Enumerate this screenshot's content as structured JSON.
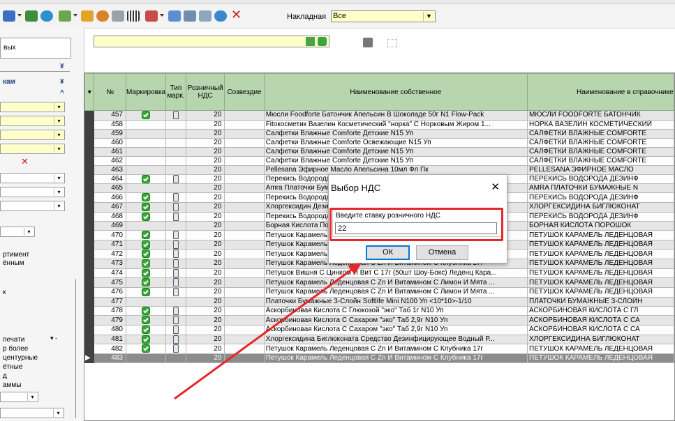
{
  "toolbar": {
    "nakladnaya_label": "Накладная",
    "nakladnaya_value": "Все",
    "icons": [
      "refresh-icon",
      "excel-icon",
      "globe-icon",
      "puzzle-icon",
      "filter-icon",
      "box-icon",
      "wrench-icon",
      "barcode-icon",
      "scale-icon",
      "copy-icon",
      "copy2-icon",
      "copy3-icon",
      "sync-icon",
      "delete-icon"
    ]
  },
  "left_panel": {
    "text_vyh": "вых",
    "text_kam": "кам",
    "text_assortiment": "ртимент",
    "text_yonnym": "ённым",
    "text_k": "к",
    "text_pechati": "печати",
    "text_p_bolee": "р более",
    "text_centurnye": "центурные",
    "text_yotnye": "ётные",
    "text_d": "д",
    "text_ammy": "аммы"
  },
  "grid": {
    "columns": [
      "№",
      "Маркировка",
      "Тип марк.",
      "Розничный НДС",
      "Созвездие",
      "Наименование собственное",
      "Наименование в справочнике"
    ],
    "rows": [
      {
        "n": "457",
        "mark": true,
        "typ": "pack",
        "nds": "20",
        "name": "Мюсли Foodforte Батончик Апельсин В Шоколаде 50г N1 Flow-Pack",
        "ref": "МЮСЛИ FOODFORTE БАТОНЧИК"
      },
      {
        "n": "458",
        "mark": false,
        "typ": "",
        "nds": "20",
        "name": "Fitoкосметик Вазелин Косметический \"норка\" С Норковым Жиром 1...",
        "ref": "НОРКА ВАЗЕЛИН КОСМЕТИЧЕСКИЙ"
      },
      {
        "n": "459",
        "mark": false,
        "typ": "",
        "nds": "20",
        "name": "Салфетки Влажные Comforte Детские N15 Уп",
        "ref": "САЛФЕТКИ ВЛАЖНЫЕ COMFORTE"
      },
      {
        "n": "460",
        "mark": false,
        "typ": "",
        "nds": "20",
        "name": "Салфетки Влажные Comforte Освежающие N15 Уп",
        "ref": "САЛФЕТКИ ВЛАЖНЫЕ COMFORTE"
      },
      {
        "n": "461",
        "mark": false,
        "typ": "",
        "nds": "20",
        "name": "Салфетки Влажные Comforte Детские N15 Уп",
        "ref": "САЛФЕТКИ ВЛАЖНЫЕ COMFORTE"
      },
      {
        "n": "462",
        "mark": false,
        "typ": "",
        "nds": "20",
        "name": "Салфетки Влажные Comforte Детские N15 Уп",
        "ref": "САЛФЕТКИ ВЛАЖНЫЕ COMFORTE"
      },
      {
        "n": "463",
        "mark": false,
        "typ": "",
        "nds": "20",
        "name": "Pellesana Эфирное Масло Апельсина 10мл Фл Пк",
        "ref": "PELLESANA ЭФИРНОЕ МАСЛО"
      },
      {
        "n": "464",
        "mark": true,
        "typ": "bottle",
        "nds": "20",
        "name": "Перекись Водорода Дезинфицирующее Средство 3% 100мл N1 Фл ...",
        "ref": "ПЕРЕКИСЬ ВОДОРОДА ДЕЗИНФ"
      },
      {
        "n": "465",
        "mark": false,
        "typ": "",
        "nds": "20",
        "name": "Amra Платочки Бумажные",
        "ref": "AMRA ПЛАТОЧКИ БУМАЖНЫЕ N"
      },
      {
        "n": "466",
        "mark": true,
        "typ": "bottle",
        "nds": "20",
        "name": "Перекись Водорода Дезинфицирующее Средство 3% 100мл N1 Фл ...",
        "ref": "ПЕРЕКИСЬ ВОДОРОДА ДЕЗИНФ"
      },
      {
        "n": "467",
        "mark": true,
        "typ": "bottle",
        "nds": "20",
        "name": "Хлоргексидин Дезинфицирующее Средство Водный 0,05% 100...",
        "ref": "ХЛОРГЕКСИДИНА БИГЛЮКОНАТ"
      },
      {
        "n": "468",
        "mark": true,
        "typ": "bottle",
        "nds": "20",
        "name": "Перекись Водорода Дезинфицирующее Средство 3% 100мл N1 Фл ...",
        "ref": "ПЕРЕКИСЬ ВОДОРОДА ДЕЗИНФ"
      },
      {
        "n": "469",
        "mark": false,
        "typ": "",
        "nds": "20",
        "name": "Борная Кислота Порошок",
        "ref": "БОРНАЯ КИСЛОТА ПОРОШОК"
      },
      {
        "n": "470",
        "mark": true,
        "typ": "pack",
        "nds": "20",
        "name": "Петушок Карамель Леденцовая С Zn (50шт Шоу-Бокс) Ле...",
        "ref": "ПЕТУШОК КАРАМЕЛЬ ЛЕДЕНЦОВАЯ"
      },
      {
        "n": "471",
        "mark": true,
        "typ": "pack",
        "nds": "20",
        "name": "Петушок Карамель Леденцовая С Zn И Витамином С Смородина Чё...",
        "ref": "ПЕТУШОК КАРАМЕЛЬ ЛЕДЕНЦОВАЯ"
      },
      {
        "n": "472",
        "mark": true,
        "typ": "pack",
        "nds": "20",
        "name": "Петушок Карамель Леденцовая С Zn И Витамином С Лесная Ягода ...",
        "ref": "ПЕТУШОК КАРАМЕЛЬ ЛЕДЕНЦОВАЯ"
      },
      {
        "n": "473",
        "mark": true,
        "typ": "pack",
        "nds": "20",
        "name": "Петушок Карамель Леденцовая С Zn И Витамином С Клубника 17г",
        "ref": "ПЕТУШОК КАРАМЕЛЬ ЛЕДЕНЦОВАЯ"
      },
      {
        "n": "474",
        "mark": true,
        "typ": "pack",
        "nds": "20",
        "name": "Петушок Вишня С Цинком И Вит С 17г (50шт Шоу-Бокс) Леденц Кара...",
        "ref": "ПЕТУШОК КАРАМЕЛЬ ЛЕДЕНЦОВАЯ"
      },
      {
        "n": "475",
        "mark": true,
        "typ": "pack",
        "nds": "20",
        "name": "Петушок Карамель Леденцовая С Zn И Витамином С Лимон И Мята ...",
        "ref": "ПЕТУШОК КАРАМЕЛЬ ЛЕДЕНЦОВАЯ"
      },
      {
        "n": "476",
        "mark": true,
        "typ": "pack",
        "nds": "20",
        "name": "Петушок Карамель Леденцовая С Zn И Витамином С Лимон И Мята ...",
        "ref": "ПЕТУШОК КАРАМЕЛЬ ЛЕДЕНЦОВАЯ"
      },
      {
        "n": "477",
        "mark": false,
        "typ": "",
        "nds": "20",
        "name": "Платочки Бумажные 3-Слойн Softlife Mini N100 Уп <10*10>-1/10",
        "ref": "ПЛАТОЧКИ БУМАЖНЫЕ 3-СЛОЙН"
      },
      {
        "n": "478",
        "mark": true,
        "typ": "pack",
        "nds": "20",
        "name": "Аскорбиновая Кислота С Глюкозой \"эко\" Таб 1г N10 Уп",
        "ref": "АСКОРБИНОВАЯ КИСЛОТА С ГЛ"
      },
      {
        "n": "479",
        "mark": true,
        "typ": "pack",
        "nds": "20",
        "name": "Аскорбиновая Кислота С Сахаром \"эко\" Таб 2,9г N10 Уп",
        "ref": "АСКОРБИНОВАЯ КИСЛОТА С СА"
      },
      {
        "n": "480",
        "mark": true,
        "typ": "pack",
        "nds": "20",
        "name": "Аскорбиновая Кислота С Сахаром \"эко\" Таб 2,9г N10 Уп",
        "ref": "АСКОРБИНОВАЯ КИСЛОТА С СА"
      },
      {
        "n": "481",
        "mark": true,
        "typ": "bottle",
        "nds": "20",
        "name": "Хлоргексидина Биглюконата Средство Дезинфицирующее Водный Р...",
        "ref": "ХЛОРГЕКСИДИНА БИГЛЮКОНАТ"
      },
      {
        "n": "482",
        "mark": true,
        "typ": "pack",
        "nds": "20",
        "name": "Петушок Карамель Леденцовая С Zn И Витамином С Клубника 17г",
        "ref": "ПЕТУШОК КАРАМЕЛЬ ЛЕДЕНЦОВАЯ"
      },
      {
        "n": "483",
        "mark": false,
        "typ": "",
        "nds": "20",
        "name": "Петушок Карамель Леденцовая С Zn И Витамином С Клубника 17г",
        "ref": "ПЕТУШОК КАРАМЕЛЬ ЛЕДЕНЦОВАЯ",
        "selected": true
      }
    ]
  },
  "dialog": {
    "title": "Выбор НДС",
    "close_glyph": "✕",
    "prompt": "Введите ставку розничного НДС",
    "input_value": "22",
    "ok_label": "ОК",
    "cancel_label": "Отмена"
  },
  "colors": {
    "header_green": "#b7d5ae",
    "highlight_red": "#e8262a",
    "input_yellow": "#ffffcc"
  }
}
